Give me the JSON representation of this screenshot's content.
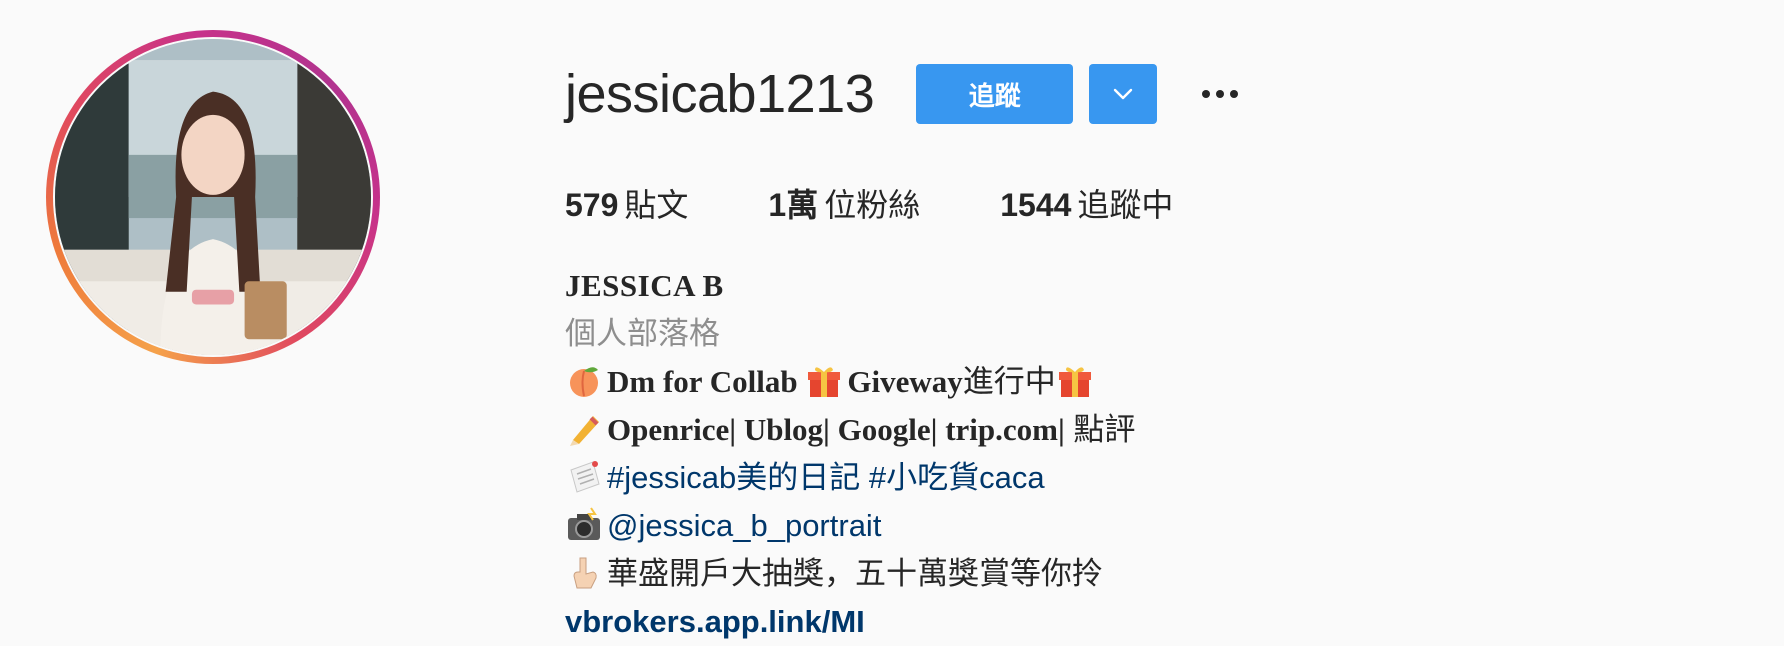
{
  "profile": {
    "username": "jessicab1213",
    "follow_label": "追蹤",
    "stats": [
      {
        "count": "579",
        "label": "貼文"
      },
      {
        "count": "1萬",
        "label": "位粉絲"
      },
      {
        "count": "1544",
        "label": "追蹤中"
      }
    ],
    "full_name": "JESSICA B",
    "category": "個人部落格",
    "bio": {
      "line1_a": "Dm for Collab ",
      "line1_b": "Giveway",
      "line1_c": "進行中",
      "line2_a": "Openrice| Ublog| Google| trip.com|",
      "line2_b": " 點評",
      "line3_tag1": "#jessicab美的日記",
      "line3_tag2": "#小吃貨caca",
      "line4_mention": "@jessica_b_portrait",
      "line5_text": "華盛開戶大抽獎，五十萬獎賞等你拎",
      "link": "vbrokers.app.link/MI"
    }
  },
  "colors": {
    "button": "#3897f0",
    "link": "#00376b",
    "muted": "#8e8e8e",
    "text": "#262626"
  },
  "icons": [
    "peach-icon",
    "gift-icon",
    "pencil-icon",
    "memo-icon",
    "camera-flash-icon",
    "pointing-down-icon",
    "chevron-down-icon",
    "more-options-icon"
  ]
}
